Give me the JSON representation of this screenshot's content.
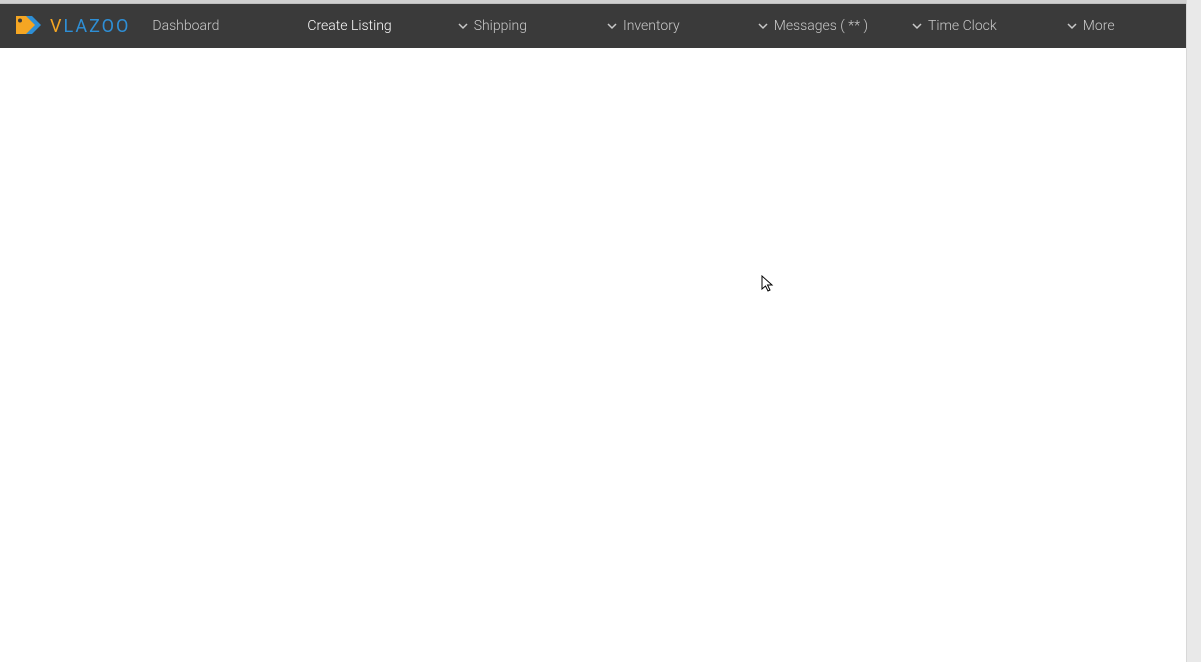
{
  "logo": {
    "first_letter": "V",
    "rest": "LAZOO"
  },
  "nav": {
    "dashboard": "Dashboard",
    "create_listing": "Create Listing",
    "shipping": "Shipping",
    "inventory": "Inventory",
    "messages": "Messages ( ** )",
    "time_clock": "Time Clock",
    "more": "More"
  }
}
